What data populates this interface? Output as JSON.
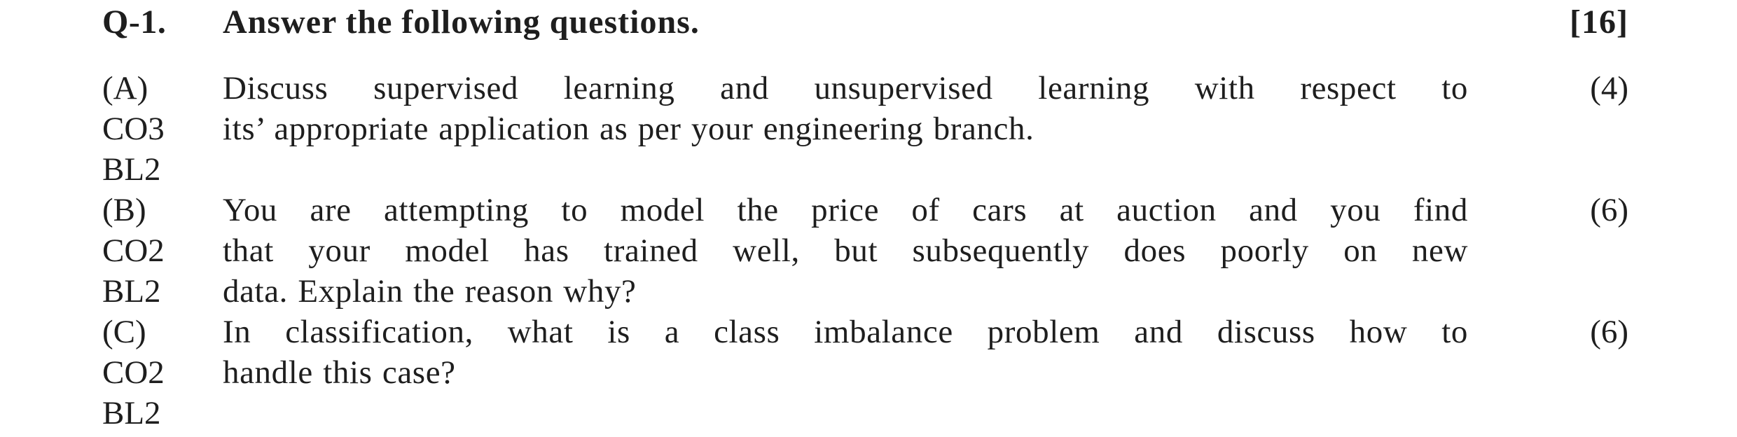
{
  "header": {
    "number": "Q-1.",
    "title": "Answer the following questions.",
    "marks": "[16]"
  },
  "questions": [
    {
      "label": "(A)",
      "co": "CO3",
      "bl": "BL2",
      "lines": [
        "Discuss supervised learning and unsupervised learning with respect to",
        "its’ appropriate application as per your engineering branch."
      ],
      "marks": "(4)"
    },
    {
      "label": "(B)",
      "co": "CO2",
      "bl": "BL2",
      "lines": [
        "You are attempting to model the price of cars at auction and you find",
        "that your model has trained well, but subsequently does poorly on new",
        "data. Explain the reason why?"
      ],
      "marks": "(6)"
    },
    {
      "label": "(C)",
      "co": "CO2",
      "bl": "BL2",
      "lines": [
        "In classification, what is a class imbalance problem and discuss how to",
        "handle this case?"
      ],
      "marks": "(6)"
    }
  ]
}
